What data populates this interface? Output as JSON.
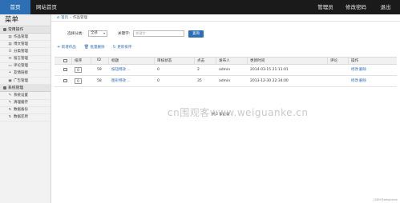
{
  "topbar": {
    "nav_home": "首页",
    "nav_site": "网站首页",
    "nav_admin": "管理员",
    "nav_password": "修改密码",
    "nav_logout": "退出"
  },
  "sidebar": {
    "title": "菜单",
    "groups": [
      {
        "label": "常用操作",
        "items": [
          {
            "label": "作品管理",
            "icon": "document-icon"
          },
          {
            "label": "博文管理",
            "icon": "document-icon"
          },
          {
            "label": "分类管理",
            "icon": "list-icon"
          },
          {
            "label": "留言管理",
            "icon": "message-icon"
          },
          {
            "label": "评论管理",
            "icon": "comment-icon"
          },
          {
            "label": "友情链接",
            "icon": "link-icon"
          },
          {
            "label": "广告管理",
            "icon": "ad-icon"
          }
        ]
      },
      {
        "label": "系统管理",
        "items": [
          {
            "label": "系统设置",
            "icon": "wrench-icon"
          },
          {
            "label": "清理缓存",
            "icon": "wrench-icon"
          },
          {
            "label": "数据备份",
            "icon": "refresh-icon"
          },
          {
            "label": "数据还原",
            "icon": "refresh-icon"
          }
        ]
      }
    ]
  },
  "breadcrumb": {
    "home": "首页",
    "current": "作品管理"
  },
  "filters": {
    "category_label": "选择分类:",
    "category_value": "全部",
    "keyword_label": "关键字:",
    "keyword_placeholder": "关键字",
    "search_button": "查询"
  },
  "actions": {
    "add": "新增作品",
    "bulk_delete": "批量删除",
    "update_sort": "更新排序"
  },
  "table": {
    "headers": {
      "sort": "排序",
      "id": "ID",
      "title": "标题",
      "status": "审核状态",
      "clicks": "点击",
      "author": "发布人",
      "updated": "更新时间",
      "comments": "评论",
      "ops": "操作"
    },
    "rows": [
      {
        "sort": "0",
        "id": "59",
        "title": "按钮特效 ...",
        "status": "0",
        "clicks": "2",
        "author": "admin",
        "updated": "2014-03-15 21:11:01",
        "comments": "",
        "edit": "修改",
        "delete": "删除"
      },
      {
        "sort": "0",
        "id": "58",
        "title": "图形特效 ...",
        "status": "0",
        "clicks": "35",
        "author": "admin",
        "updated": "2013-12-30 22:34:00",
        "comments": "",
        "edit": "修改",
        "delete": "删除"
      }
    ]
  },
  "pager": "共 2 条记录",
  "watermark": "cn围观客www.weiguanke.cn",
  "footer": "CSDN @weiguanke",
  "colors": {
    "topbar": "#1a1a1a",
    "accent": "#2c6fb5",
    "sidebar_bg": "#f2f2f2"
  }
}
